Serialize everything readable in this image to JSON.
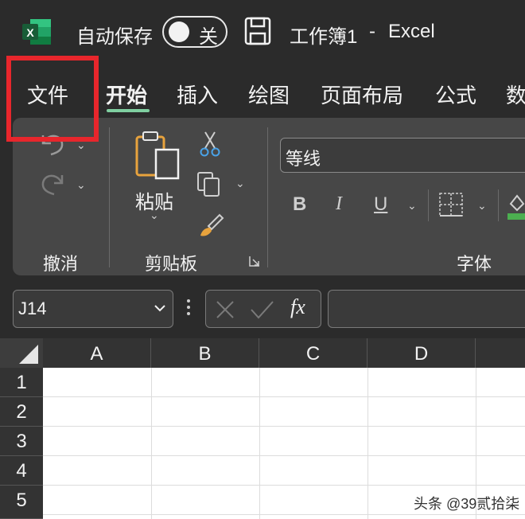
{
  "titlebar": {
    "autosave_label": "自动保存",
    "autosave_state": "关",
    "doc_title": "工作簿1",
    "separator": "-",
    "app_name": "Excel"
  },
  "tabs": [
    "文件",
    "开始",
    "插入",
    "绘图",
    "页面布局",
    "公式",
    "数"
  ],
  "active_tab_index": 1,
  "ribbon": {
    "undo_group_label": "撤消",
    "clipboard": {
      "paste_label": "粘贴",
      "group_label": "剪贴板"
    },
    "font": {
      "font_name": "等线",
      "bold": "B",
      "italic": "I",
      "underline": "U",
      "group_label": "字体"
    }
  },
  "formula_bar": {
    "name_box": "J14",
    "fx": "fx"
  },
  "grid": {
    "columns": [
      "A",
      "B",
      "C",
      "D"
    ],
    "rows": [
      "1",
      "2",
      "3",
      "4",
      "5"
    ]
  },
  "watermark": "头条 @39贰拾柒",
  "colors": {
    "accent": "#7fcfa0",
    "highlight_box": "#e8262c",
    "excel_green": "#1e7145"
  }
}
